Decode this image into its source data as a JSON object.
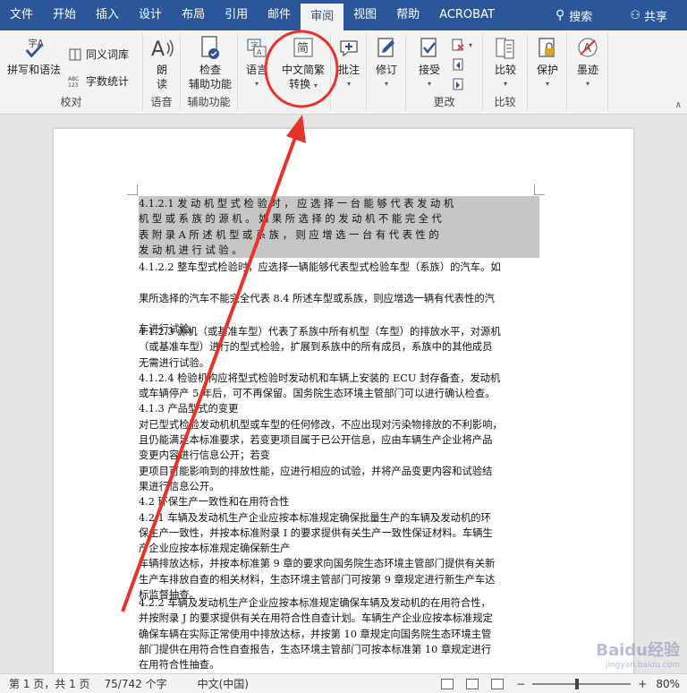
{
  "tabs": [
    "文件",
    "开始",
    "插入",
    "设计",
    "布局",
    "引用",
    "邮件",
    "审阅",
    "视图",
    "帮助",
    "ACROBAT"
  ],
  "active_tab": "审阅",
  "search_label": "搜索",
  "share_label": "共享",
  "ribbon": {
    "proofing": {
      "spelling": "拼写和语法",
      "thesaurus": "同义词库",
      "wordcount": "字数统计",
      "label": "校对"
    },
    "speech": {
      "read_line1": "朗",
      "read_line2": "读",
      "label": "语音"
    },
    "accessibility": {
      "check_line1": "检查",
      "check_line2": "辅助功能",
      "label": "辅助功能"
    },
    "language": {
      "lang": "语言"
    },
    "chinese": {
      "line1": "中文简繁",
      "line2": "转换"
    },
    "comments": {
      "label": "批注"
    },
    "tracking": {
      "label": "修订"
    },
    "changes": {
      "accept": "接受",
      "label": "更改"
    },
    "compare": {
      "compare": "比较",
      "label": "比较"
    },
    "protect": {
      "protect": "保护"
    },
    "ink": {
      "ink": "墨迹"
    },
    "ink_icon_text": "A"
  },
  "document": {
    "p1_lines": [
      "4.1.2.1 发 动 机 型 式 检 验 时 ， 应 选 择 一 台 能 够 代 表 发 动 机",
      "机 型 或 系 族 的 源 机 。 如 果 所 选 择 的 发 动 机 不 能 完 全 代",
      "表 附 录  A  所 述 机 型 或 系 族 ， 则 应 增 选 一 台 有 代 表 性 的",
      "发 动 机 进 行 试 验 。"
    ],
    "p2_lines": [
      "4.1.2.2 整车型式检验时，应选择一辆能够代表型式检验车型（系族）的汽车。如",
      "",
      "果所选择的汽车不能完全代表 8.4 所述车型或系族，则应增选一辆有代表性的汽",
      "",
      "车进行试验。"
    ],
    "p3_lines": [
      "4.1.2.3 源机（或基准车型）代表了系族中所有机型（车型）的排放水平，对源机",
      "（或基准车型）进行的型式检验，扩展到系族中的所有成员，系族中的其他成员",
      "无需进行试验。",
      "4.1.2.4 检验机构应将型式检验时发动机和车辆上安装的 ECU 封存备查，发动机",
      "或车辆停产 5 年后，可不再保留。国务院生态环境主管部门可以进行确认检查。",
      "4.1.3 产品型式的变更",
      "对已型式检验发动机机型或车型的任何修改，不应出现对污染物排放的不利影响，",
      "且仍能满足本标准要求，若变更项目属于已公开信息，应由车辆生产企业将产品",
      "变更内容进行信息公开；若变",
      "更项目可能影响到的排放性能，应进行相应的试验，并将产品变更内容和试验结",
      "果进行信息公开。",
      "4.2 环保生产一致性和在用符合性",
      "4.2.1  车辆及发动机生产企业应按本标准规定确保批量生产的车辆及发动机的环",
      "保生产一致性，并按本标准附录 I 的要求提供有关生产一致性保证材料。车辆生",
      "产企业应按本标准规定确保新生产",
      "车辆排放达标，并按本标准第 9 章的要求向国务院生态环境主管部门提供有关新",
      "生产车排放自查的相关材料，生态环境主管部门可按第 9 章规定进行新生产车达",
      "标监督抽查。"
    ],
    "p4_lines": [
      "4.2.2  车辆及发动机生产企业应按本标准规定确保车辆及发动机的在用符合性，",
      "并按附录 J 的要求提供有关在用符合性自查计划。车辆生产企业应按本标准规定",
      "确保车辆在实际正常使用中排放达标，并按第 10 章规定向国务院生态环境主管",
      "部门提供在用符合性自查报告，生态环境主管部门可按本标准第 10 章规定进行",
      "在用符合性抽查。"
    ]
  },
  "status": {
    "page": "第 1 页，共 1 页",
    "words": "75/742 个字",
    "lang": "中文(中国)",
    "zoom": "80%",
    "minus": "−",
    "plus": "+"
  },
  "watermark": {
    "main": "Baidu经验",
    "sub": "jingyan.baidu.com"
  },
  "colors": {
    "accent": "#2b579a",
    "annotation": "#e8322b",
    "selection": "#c6c6c6"
  }
}
